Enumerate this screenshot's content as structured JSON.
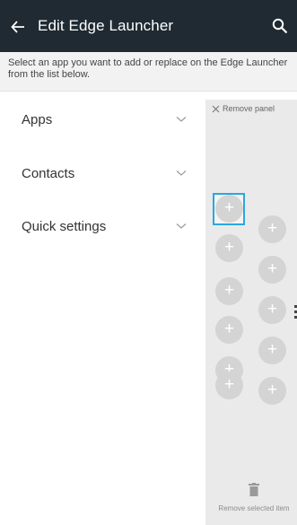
{
  "header": {
    "title": "Edit Edge Launcher",
    "back_icon": "arrow-left-icon",
    "search_icon": "search-icon",
    "background": "#1f2a32"
  },
  "instructions": "Select an app you want to add or replace on the Edge Launcher from the list below.",
  "categories": [
    {
      "label": "Apps"
    },
    {
      "label": "Contacts"
    },
    {
      "label": "Quick settings"
    }
  ],
  "panel": {
    "remove_panel_label": "Remove panel",
    "remove_selected_label": "Remove selected item",
    "slot_glyph": "+",
    "selected_color": "#2aa7df"
  }
}
